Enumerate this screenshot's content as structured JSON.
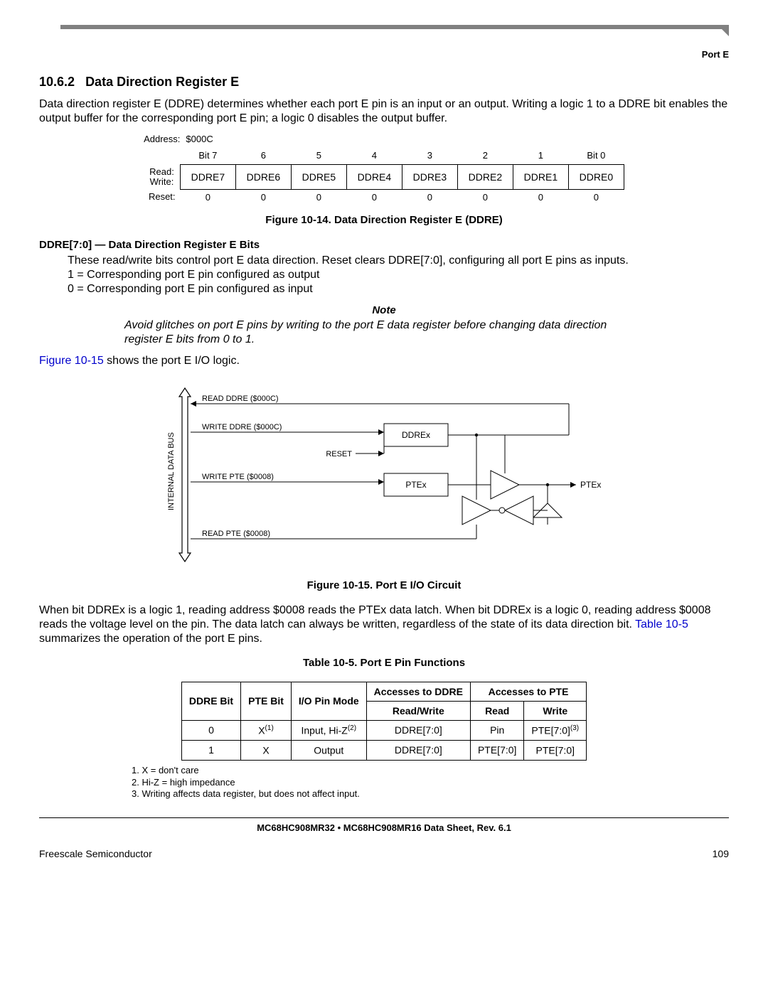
{
  "header": {
    "port": "Port E"
  },
  "section": {
    "number": "10.6.2",
    "title": "Data Direction Register E",
    "intro": "Data direction register E (DDRE) determines whether each port E pin is an input or an output. Writing a logic 1 to a DDRE bit enables the output buffer for the corresponding port E pin; a logic 0 disables the output buffer."
  },
  "register": {
    "address_label": "Address:",
    "address": "$000C",
    "bit_headers": [
      "Bit 7",
      "6",
      "5",
      "4",
      "3",
      "2",
      "1",
      "Bit 0"
    ],
    "rw_label_read": "Read:",
    "rw_label_write": "Write:",
    "fields": [
      "DDRE7",
      "DDRE6",
      "DDRE5",
      "DDRE4",
      "DDRE3",
      "DDRE2",
      "DDRE1",
      "DDRE0"
    ],
    "reset_label": "Reset:",
    "reset": [
      "0",
      "0",
      "0",
      "0",
      "0",
      "0",
      "0",
      "0"
    ],
    "caption": "Figure 10-14. Data Direction Register E (DDRE)"
  },
  "field_desc": {
    "title": "DDRE[7:0] — Data Direction Register E Bits",
    "para": "These read/write bits control port E data direction. Reset clears DDRE[7:0], configuring all port E pins as inputs.",
    "line1": "1 = Corresponding port E pin configured as output",
    "line0": "0 = Corresponding port E pin configured as input"
  },
  "note": {
    "label": "Note",
    "body": "Avoid glitches on port E pins by writing to the port E data register before changing data direction register E bits from 0 to 1."
  },
  "fig15_intro_link": "Figure 10-15",
  "fig15_intro_rest": " shows the port E I/O logic.",
  "diagram": {
    "bus_label": "INTERNAL DATA BUS",
    "sig_read_ddre": "READ DDRE ($000C)",
    "sig_write_ddre": "WRITE DDRE ($000C)",
    "sig_reset": "RESET",
    "box_ddrex": "DDREx",
    "sig_write_pte": "WRITE PTE ($0008)",
    "box_ptex": "PTEx",
    "sig_read_pte": "READ PTE ($0008)",
    "out_ptex": "PTEx",
    "caption": "Figure 10-15. Port E I/O Circuit"
  },
  "para2_a": "When bit DDREx is a logic 1, reading address $0008 reads the PTEx data latch. When bit DDREx is a logic 0, reading address $0008 reads the voltage level on the pin. The data latch can always be written, regardless of the state of its data direction bit. ",
  "para2_link": "Table 10-5",
  "para2_b": " summarizes the operation of the port E pins.",
  "table": {
    "caption": "Table 10-5. Port E Pin Functions",
    "hdr_ddre": "DDRE Bit",
    "hdr_pte": "PTE Bit",
    "hdr_mode": "I/O Pin Mode",
    "hdr_acc_ddre": "Accesses to DDRE",
    "hdr_acc_pte": "Accesses to PTE",
    "hdr_rw": "Read/Write",
    "hdr_read": "Read",
    "hdr_write": "Write",
    "rows": [
      {
        "ddre": "0",
        "pte": "X",
        "pte_sup": "(1)",
        "mode": "Input, Hi-Z",
        "mode_sup": "(2)",
        "acc_ddre": "DDRE[7:0]",
        "read": "Pin",
        "write": "PTE[7:0]",
        "write_sup": "(3)"
      },
      {
        "ddre": "1",
        "pte": "X",
        "pte_sup": "",
        "mode": "Output",
        "mode_sup": "",
        "acc_ddre": "DDRE[7:0]",
        "read": "PTE[7:0]",
        "write": "PTE[7:0]",
        "write_sup": ""
      }
    ],
    "notes": [
      "1. X = don't care",
      "2. Hi-Z = high impedance",
      "3. Writing affects data register, but does not affect input."
    ]
  },
  "footer": {
    "doc": "MC68HC908MR32 • MC68HC908MR16 Data Sheet, Rev. 6.1",
    "left": "Freescale Semiconductor",
    "right": "109"
  }
}
